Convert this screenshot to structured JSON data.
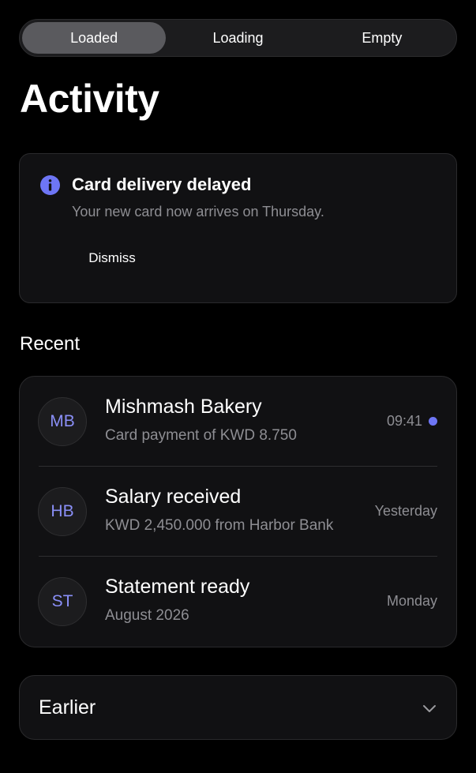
{
  "segments": [
    {
      "label": "Loaded",
      "active": true
    },
    {
      "label": "Loading",
      "active": false
    },
    {
      "label": "Empty",
      "active": false
    }
  ],
  "page": {
    "title": "Activity"
  },
  "alert": {
    "icon": "info-icon",
    "title": "Card delivery delayed",
    "body": "Your new card now arrives on Thursday.",
    "dismiss_label": "Dismiss"
  },
  "recent": {
    "title": "Recent",
    "items": [
      {
        "initials": "MB",
        "title": "Mishmash Bakery",
        "subtitle": "Card payment of KWD 8.750",
        "time": "09:41",
        "unread": true
      },
      {
        "initials": "HB",
        "title": "Salary received",
        "subtitle": "KWD 2,450.000 from Harbor Bank",
        "time": "Yesterday",
        "unread": false
      },
      {
        "initials": "ST",
        "title": "Statement ready",
        "subtitle": "August 2026",
        "time": "Monday",
        "unread": false
      }
    ]
  },
  "earlier": {
    "label": "Earlier",
    "icon": "chevron-down-icon"
  },
  "colors": {
    "accent": "#6e76f5",
    "avatar_text": "#8a8ff7",
    "muted_text": "#8e8e93"
  }
}
